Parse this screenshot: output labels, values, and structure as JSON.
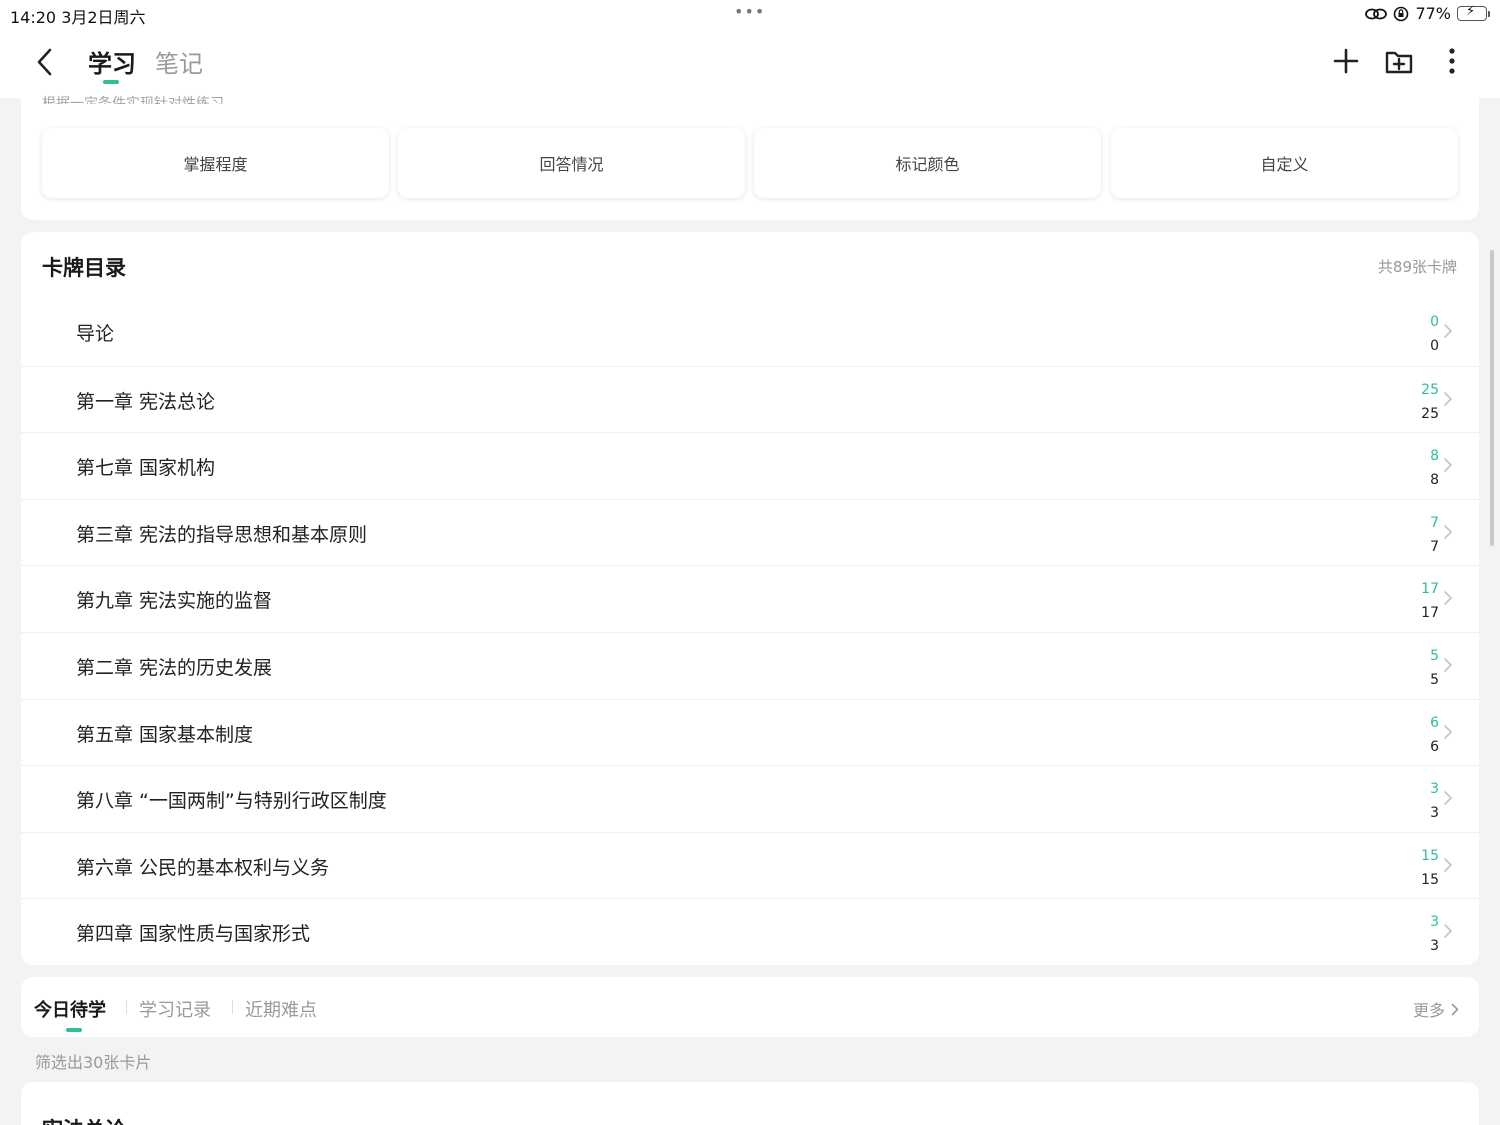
{
  "status_bar": {
    "time_date": "14:20   3月2日周六",
    "dots": "•••",
    "battery_percent": "77%",
    "battery_level": 0.77
  },
  "header": {
    "tabs": [
      {
        "label": "学习"
      },
      {
        "label": "笔记"
      }
    ]
  },
  "filters": {
    "hint": "根据一定条件实现针对性练习",
    "buttons": [
      {
        "label": "掌握程度"
      },
      {
        "label": "回答情况"
      },
      {
        "label": "标记颜色"
      },
      {
        "label": "自定义"
      }
    ]
  },
  "catalog": {
    "title": "卡牌目录",
    "count": "共89张卡牌",
    "items": [
      {
        "label": "导论",
        "due": "0",
        "total": "0"
      },
      {
        "label": "第一章 宪法总论",
        "due": "25",
        "total": "25"
      },
      {
        "label": "第七章 国家机构",
        "due": "8",
        "total": "8"
      },
      {
        "label": "第三章 宪法的指导思想和基本原则",
        "due": "7",
        "total": "7"
      },
      {
        "label": "第九章 宪法实施的监督",
        "due": "17",
        "total": "17"
      },
      {
        "label": "第二章 宪法的历史发展",
        "due": "5",
        "total": "5"
      },
      {
        "label": "第五章 国家基本制度",
        "due": "6",
        "total": "6"
      },
      {
        "label": "第八章 “一国两制”与特别行政区制度",
        "due": "3",
        "total": "3"
      },
      {
        "label": "第六章 公民的基本权利与义务",
        "due": "15",
        "total": "15"
      },
      {
        "label": "第四章 国家性质与国家形式",
        "due": "3",
        "total": "3"
      }
    ]
  },
  "study_tabs": {
    "tabs": [
      {
        "label": "今日待学"
      },
      {
        "label": "学习记录"
      },
      {
        "label": "近期难点"
      }
    ],
    "more": "更多"
  },
  "filter_result": "筛选出30张卡片",
  "bottom_card": {
    "title": "宪法总论"
  },
  "colors": {
    "accent": "#2bbf9a",
    "background": "#f2f3f5"
  }
}
